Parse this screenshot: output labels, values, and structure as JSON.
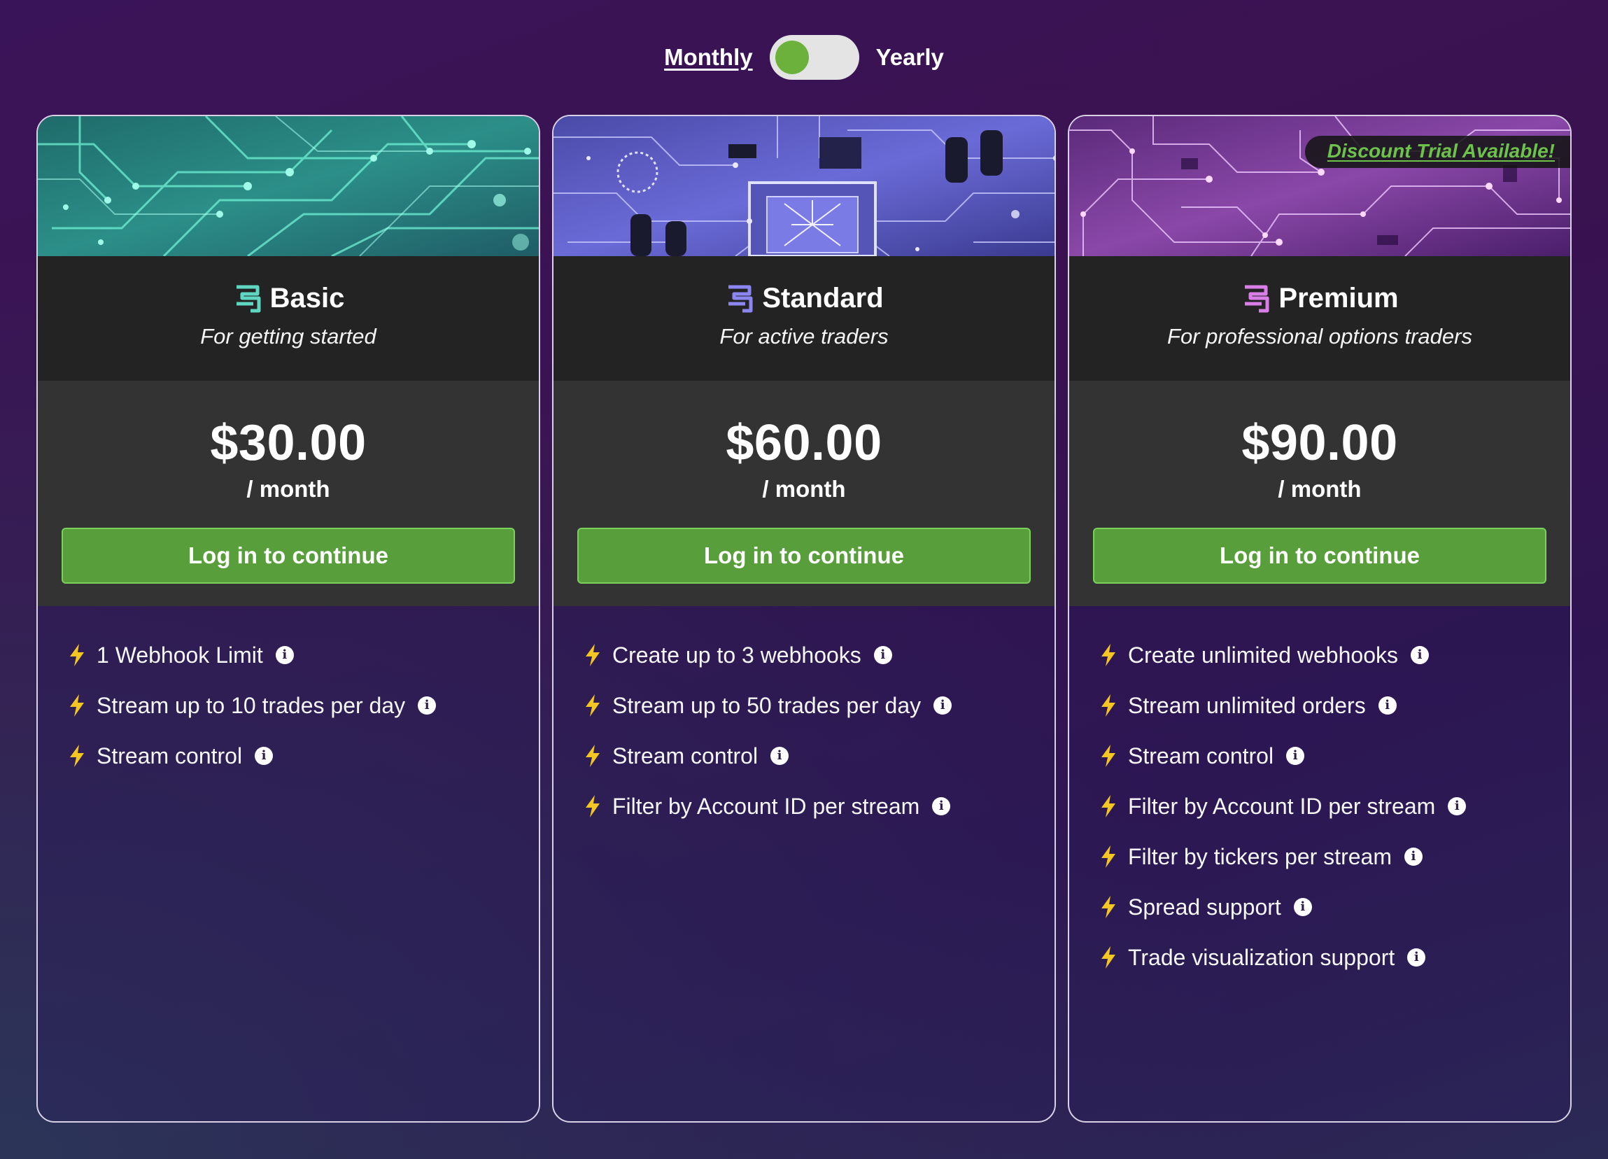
{
  "billing_toggle": {
    "monthly_label": "Monthly",
    "yearly_label": "Yearly",
    "selected": "Monthly"
  },
  "colors": {
    "accent_green": "#589e3a",
    "badge_green": "#6cc24a",
    "basic_icon": "#5fd6c2",
    "standard_icon": "#8c86f0",
    "premium_icon": "#d97ee6",
    "bolt": "#f3c623"
  },
  "plans": [
    {
      "name": "Basic",
      "tagline": "For getting started",
      "price": "$30.00",
      "period": "/ month",
      "cta": "Log in to continue",
      "banner_theme": "teal-circuit",
      "features": [
        "1 Webhook Limit",
        "Stream up to 10 trades per day",
        "Stream control"
      ]
    },
    {
      "name": "Standard",
      "tagline": "For active traders",
      "price": "$60.00",
      "period": "/ month",
      "cta": "Log in to continue",
      "banner_theme": "blue-motherboard",
      "features": [
        "Create up to 3 webhooks",
        "Stream up to 50 trades per day",
        "Stream control",
        "Filter by Account ID per stream"
      ]
    },
    {
      "name": "Premium",
      "tagline": "For professional options traders",
      "price": "$90.00",
      "period": "/ month",
      "cta": "Log in to continue",
      "banner_theme": "purple-circuit",
      "badge": "Discount Trial Available!",
      "features": [
        "Create unlimited webhooks",
        "Stream unlimited orders",
        "Stream control",
        "Filter by Account ID per stream",
        "Filter by tickers per stream",
        "Spread support",
        "Trade visualization support"
      ]
    }
  ]
}
